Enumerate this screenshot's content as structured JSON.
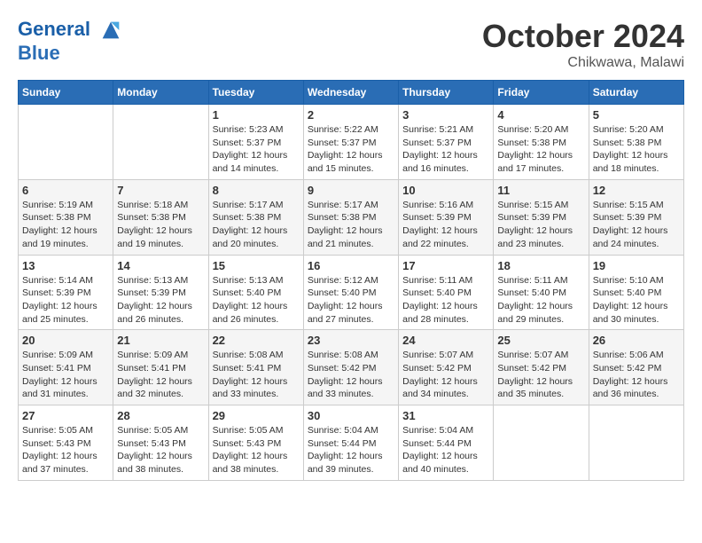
{
  "header": {
    "logo_line1": "General",
    "logo_line2": "Blue",
    "month": "October 2024",
    "location": "Chikwawa, Malawi"
  },
  "weekdays": [
    "Sunday",
    "Monday",
    "Tuesday",
    "Wednesday",
    "Thursday",
    "Friday",
    "Saturday"
  ],
  "weeks": [
    [
      {
        "day": "",
        "info": ""
      },
      {
        "day": "",
        "info": ""
      },
      {
        "day": "1",
        "info": "Sunrise: 5:23 AM\nSunset: 5:37 PM\nDaylight: 12 hours and 14 minutes."
      },
      {
        "day": "2",
        "info": "Sunrise: 5:22 AM\nSunset: 5:37 PM\nDaylight: 12 hours and 15 minutes."
      },
      {
        "day": "3",
        "info": "Sunrise: 5:21 AM\nSunset: 5:37 PM\nDaylight: 12 hours and 16 minutes."
      },
      {
        "day": "4",
        "info": "Sunrise: 5:20 AM\nSunset: 5:38 PM\nDaylight: 12 hours and 17 minutes."
      },
      {
        "day": "5",
        "info": "Sunrise: 5:20 AM\nSunset: 5:38 PM\nDaylight: 12 hours and 18 minutes."
      }
    ],
    [
      {
        "day": "6",
        "info": "Sunrise: 5:19 AM\nSunset: 5:38 PM\nDaylight: 12 hours and 19 minutes."
      },
      {
        "day": "7",
        "info": "Sunrise: 5:18 AM\nSunset: 5:38 PM\nDaylight: 12 hours and 19 minutes."
      },
      {
        "day": "8",
        "info": "Sunrise: 5:17 AM\nSunset: 5:38 PM\nDaylight: 12 hours and 20 minutes."
      },
      {
        "day": "9",
        "info": "Sunrise: 5:17 AM\nSunset: 5:38 PM\nDaylight: 12 hours and 21 minutes."
      },
      {
        "day": "10",
        "info": "Sunrise: 5:16 AM\nSunset: 5:39 PM\nDaylight: 12 hours and 22 minutes."
      },
      {
        "day": "11",
        "info": "Sunrise: 5:15 AM\nSunset: 5:39 PM\nDaylight: 12 hours and 23 minutes."
      },
      {
        "day": "12",
        "info": "Sunrise: 5:15 AM\nSunset: 5:39 PM\nDaylight: 12 hours and 24 minutes."
      }
    ],
    [
      {
        "day": "13",
        "info": "Sunrise: 5:14 AM\nSunset: 5:39 PM\nDaylight: 12 hours and 25 minutes."
      },
      {
        "day": "14",
        "info": "Sunrise: 5:13 AM\nSunset: 5:39 PM\nDaylight: 12 hours and 26 minutes."
      },
      {
        "day": "15",
        "info": "Sunrise: 5:13 AM\nSunset: 5:40 PM\nDaylight: 12 hours and 26 minutes."
      },
      {
        "day": "16",
        "info": "Sunrise: 5:12 AM\nSunset: 5:40 PM\nDaylight: 12 hours and 27 minutes."
      },
      {
        "day": "17",
        "info": "Sunrise: 5:11 AM\nSunset: 5:40 PM\nDaylight: 12 hours and 28 minutes."
      },
      {
        "day": "18",
        "info": "Sunrise: 5:11 AM\nSunset: 5:40 PM\nDaylight: 12 hours and 29 minutes."
      },
      {
        "day": "19",
        "info": "Sunrise: 5:10 AM\nSunset: 5:40 PM\nDaylight: 12 hours and 30 minutes."
      }
    ],
    [
      {
        "day": "20",
        "info": "Sunrise: 5:09 AM\nSunset: 5:41 PM\nDaylight: 12 hours and 31 minutes."
      },
      {
        "day": "21",
        "info": "Sunrise: 5:09 AM\nSunset: 5:41 PM\nDaylight: 12 hours and 32 minutes."
      },
      {
        "day": "22",
        "info": "Sunrise: 5:08 AM\nSunset: 5:41 PM\nDaylight: 12 hours and 33 minutes."
      },
      {
        "day": "23",
        "info": "Sunrise: 5:08 AM\nSunset: 5:42 PM\nDaylight: 12 hours and 33 minutes."
      },
      {
        "day": "24",
        "info": "Sunrise: 5:07 AM\nSunset: 5:42 PM\nDaylight: 12 hours and 34 minutes."
      },
      {
        "day": "25",
        "info": "Sunrise: 5:07 AM\nSunset: 5:42 PM\nDaylight: 12 hours and 35 minutes."
      },
      {
        "day": "26",
        "info": "Sunrise: 5:06 AM\nSunset: 5:42 PM\nDaylight: 12 hours and 36 minutes."
      }
    ],
    [
      {
        "day": "27",
        "info": "Sunrise: 5:05 AM\nSunset: 5:43 PM\nDaylight: 12 hours and 37 minutes."
      },
      {
        "day": "28",
        "info": "Sunrise: 5:05 AM\nSunset: 5:43 PM\nDaylight: 12 hours and 38 minutes."
      },
      {
        "day": "29",
        "info": "Sunrise: 5:05 AM\nSunset: 5:43 PM\nDaylight: 12 hours and 38 minutes."
      },
      {
        "day": "30",
        "info": "Sunrise: 5:04 AM\nSunset: 5:44 PM\nDaylight: 12 hours and 39 minutes."
      },
      {
        "day": "31",
        "info": "Sunrise: 5:04 AM\nSunset: 5:44 PM\nDaylight: 12 hours and 40 minutes."
      },
      {
        "day": "",
        "info": ""
      },
      {
        "day": "",
        "info": ""
      }
    ]
  ]
}
